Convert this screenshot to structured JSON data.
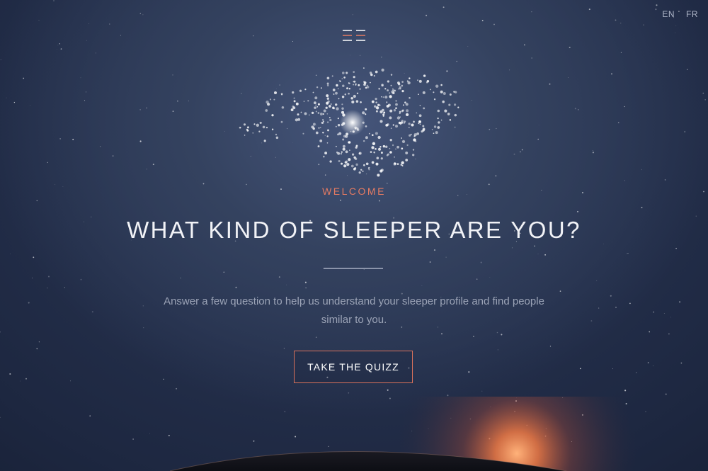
{
  "header": {
    "languages": [
      "EN",
      "FR"
    ],
    "menu_icon": "hamburger-menu-icon"
  },
  "hero": {
    "welcome": "WELCOME",
    "title": "WHAT KIND OF SLEEPER ARE YOU?",
    "subtitle_line1": "Answer a few question to help us understand your sleeper profile and find people",
    "subtitle_line2": "similar to you.",
    "cta_label": "TAKE THE QUIZZ"
  },
  "colors": {
    "accent": "#e57b62",
    "background": "#1f2a44",
    "text": "#f1f2f6"
  }
}
